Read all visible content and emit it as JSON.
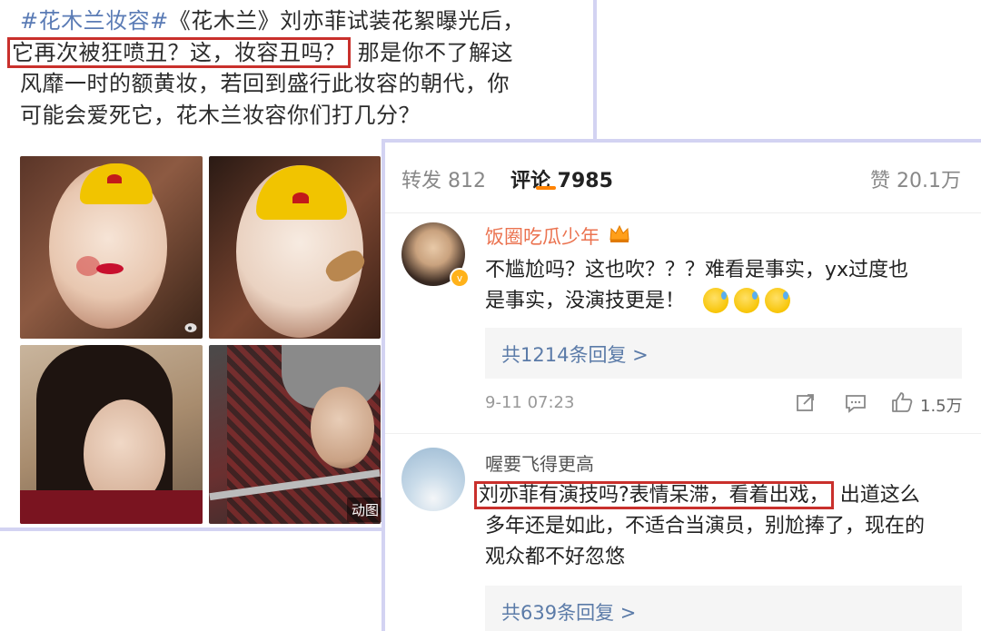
{
  "post": {
    "tag": "#花木兰妆容#",
    "line1_rest": "《花木兰》刘亦菲试装花絮曝光后，",
    "highlight": "它再次被狂喷丑？这，妆容丑吗？",
    "line2_rest": "那是你不了解这",
    "line3": "风靡一时的额黄妆，若回到盛行此妆容的朝代，你",
    "line4": "可能会爱死它，花木兰妆容你们打几分？",
    "gif_badge": "动图"
  },
  "tabs": {
    "repost": "转发 812",
    "comment": "评论 7985",
    "like": "赞 20.1万"
  },
  "comment1": {
    "username": "饭圈吃瓜少年",
    "line1": "不尴尬吗？这也吹？？？难看是事实，yx过度也",
    "line2": "是事实，没演技更是！",
    "replies": "共1214条回复 >",
    "time": "9-11 07:23",
    "likes": "1.5万"
  },
  "comment2": {
    "username": "喔要飞得更高",
    "highlight": "刘亦菲有演技吗?表情呆滞，看着出戏，",
    "line1_rest": "出道这么",
    "line2": "多年还是如此，不适合当演员，别尬捧了，现在的",
    "line3": "观众都不好忽悠",
    "replies": "共639条回复 >"
  },
  "colors": {
    "highlight_border": "#c9302c",
    "tag_blue": "#5a7bb5",
    "username_orange": "#eb7350",
    "tab_accent": "#ff8200",
    "card_border": "#d3d3f2"
  }
}
